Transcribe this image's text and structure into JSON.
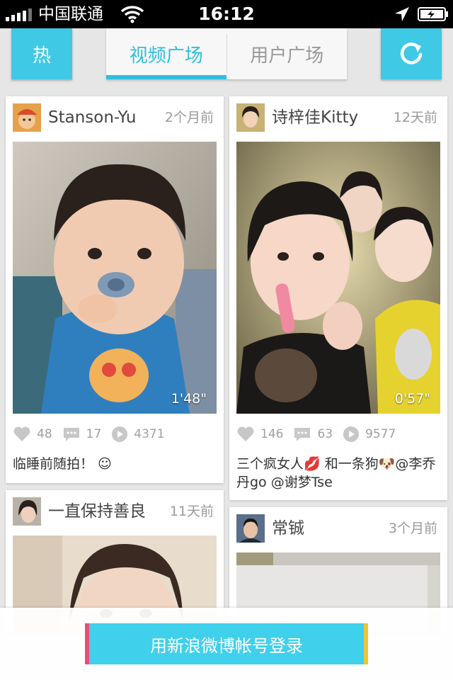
{
  "status_bar": {
    "carrier": "中国联通",
    "time": "16:12"
  },
  "header": {
    "hot_label": "热",
    "tabs": [
      {
        "label": "视频广场",
        "active": true
      },
      {
        "label": "用户广场",
        "active": false
      }
    ],
    "refresh_icon": "refresh-icon"
  },
  "cards": [
    {
      "username": "Stanson-Yu",
      "time": "2个月前",
      "duration": "1'48\"",
      "likes": "48",
      "comments": "17",
      "plays": "4371",
      "caption": "临睡前随拍！ ☺"
    },
    {
      "username": "诗梓佳Kitty",
      "time": "12天前",
      "duration": "0'57\"",
      "likes": "146",
      "comments": "63",
      "plays": "9577",
      "caption": "三个疯女人💋 和一条狗🐶@李乔丹go @谢梦Tse"
    },
    {
      "username": "一直保持善良",
      "time": "11天前"
    },
    {
      "username": "常铖",
      "time": "3个月前"
    }
  ],
  "login": {
    "label": "用新浪微博帐号登录"
  },
  "colors": {
    "accent": "#3fc9e5",
    "tab_active": "#2fc0df",
    "login_left_stripe": "#e94e7a",
    "login_right_stripe": "#f1c232"
  }
}
